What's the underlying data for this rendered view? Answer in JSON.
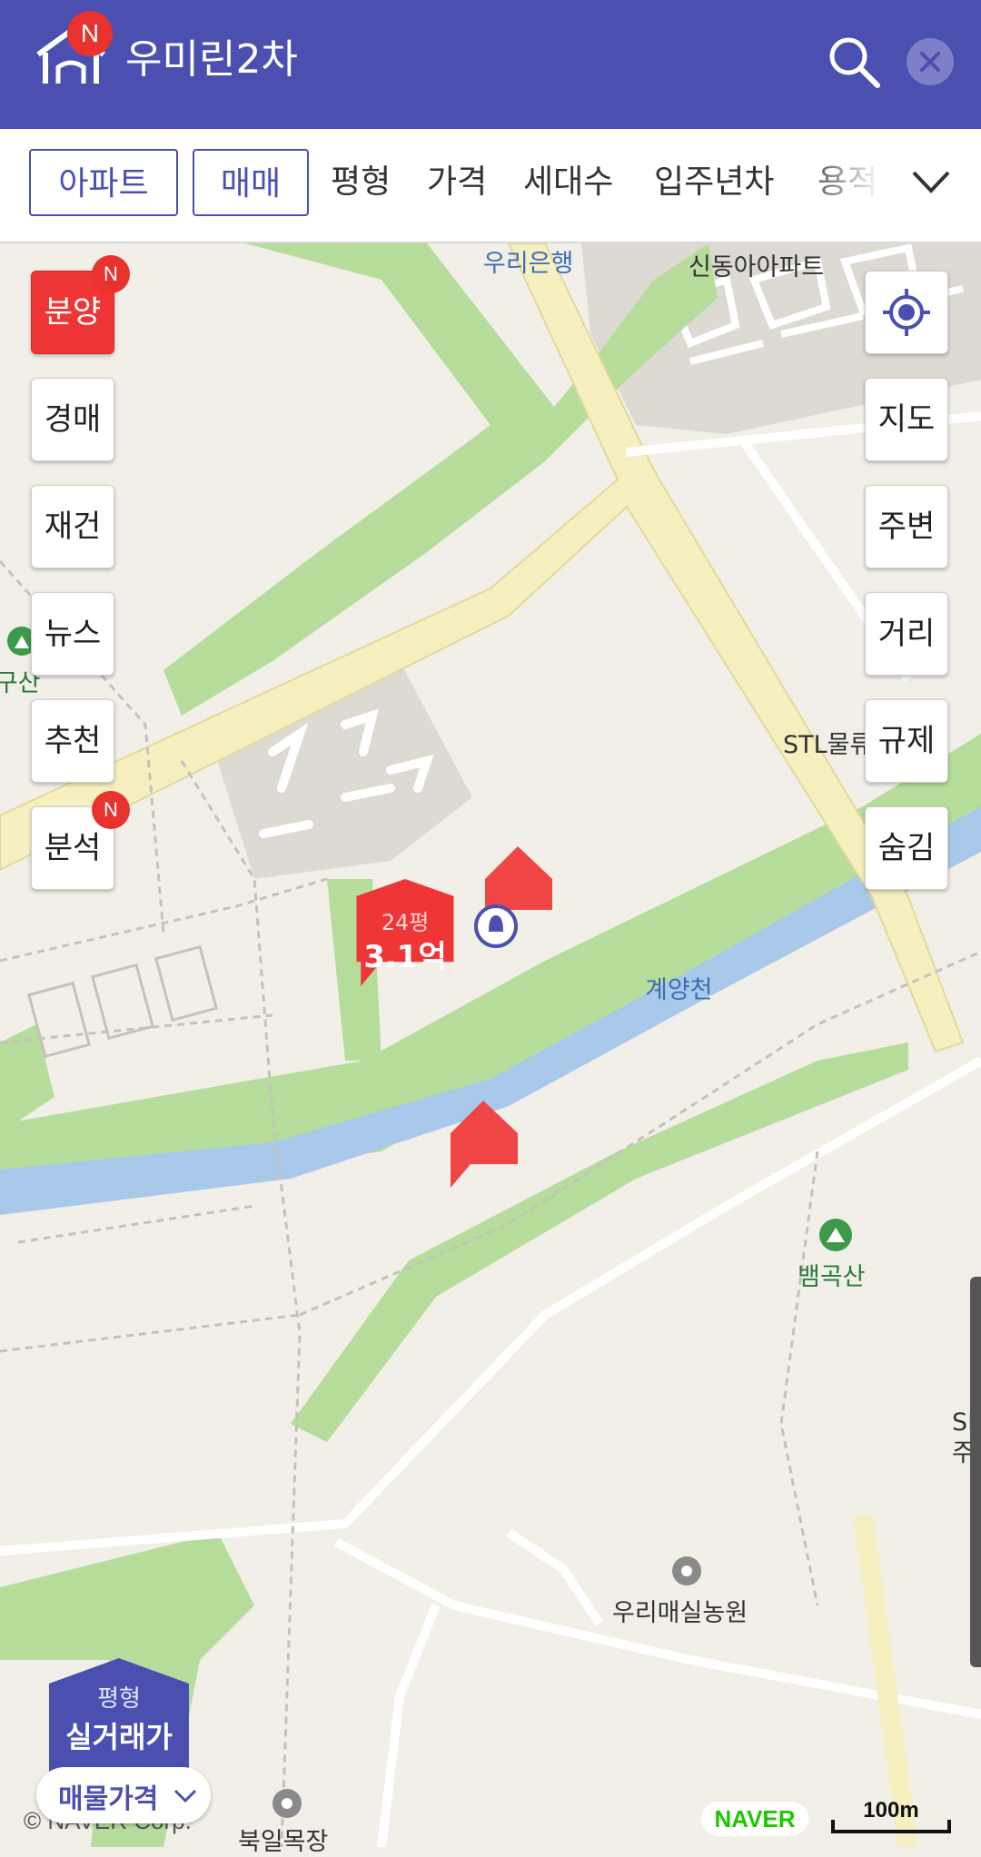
{
  "header": {
    "title": "우미린2차",
    "new_badge": "N"
  },
  "filters": {
    "chips": [
      "아파트",
      "매매"
    ],
    "items": [
      "평형",
      "가격",
      "세대수",
      "입주년차",
      "용적"
    ]
  },
  "map": {
    "labels": {
      "bank": "우리은행",
      "apartment": "신동아아파트",
      "left_cut": "장구산",
      "company": "STL물류센터",
      "stream": "계양천",
      "mountain": "뱀곡산",
      "farm": "우리매실농원",
      "ranch": "북일목장",
      "right_cut": "SK주"
    },
    "price_marker": {
      "size": "24평",
      "price": "3.1억"
    }
  },
  "left_buttons": [
    {
      "label": "분양",
      "badge": "N"
    },
    {
      "label": "경매"
    },
    {
      "label": "재건"
    },
    {
      "label": "뉴스"
    },
    {
      "label": "추천"
    },
    {
      "label": "분석",
      "badge": "N"
    }
  ],
  "right_buttons": [
    "지도",
    "주변",
    "거리",
    "규제",
    "숨김"
  ],
  "bottom": {
    "price_type_small": "평형",
    "price_type_big": "실거래가",
    "listing_toggle": "매물가격",
    "copyright": "© NAVER Corp.",
    "naver_logo": "NAVER",
    "scale": "100m"
  },
  "colors": {
    "header": "#4b50b0",
    "accent_red": "#ef3535",
    "road_yellow": "#f6efbf",
    "park_green": "#b6dd9c",
    "water_blue": "#a9c9ea"
  }
}
